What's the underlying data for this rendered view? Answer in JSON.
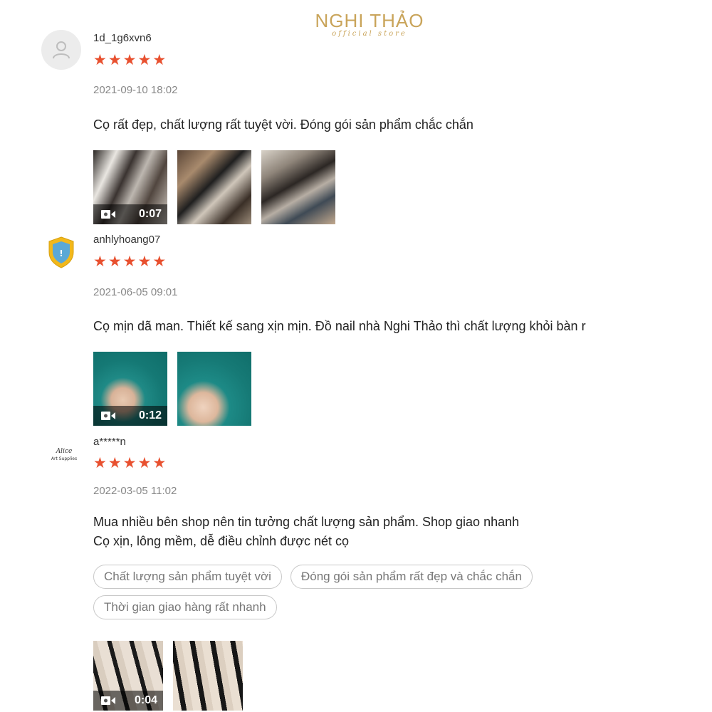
{
  "brand": {
    "name": "NGHI THẢO",
    "subtitle": "official store"
  },
  "reviews": [
    {
      "username": "1d_1g6xvn6",
      "avatar": "user-silhouette-icon",
      "rating": 5,
      "date": "2021-09-10 18:02",
      "comment": [
        "Cọ rất đẹp, chất lượng rất tuyệt vời. Đóng gói sản phẩm chắc chắn"
      ],
      "video_duration": "0:07",
      "media_count": 3
    },
    {
      "username": "anhlyhoang07",
      "avatar": "gold-shield-badge-icon",
      "rating": 5,
      "date": "2021-06-05 09:01",
      "comment": [
        "Cọ mịn dã man. Thiết kế sang xịn mịn. Đồ nail nhà Nghi Thảo thì chất lượng khỏi bàn r"
      ],
      "video_duration": "0:12",
      "media_count": 2
    },
    {
      "username": "a*****n",
      "avatar": "art-supplies-logo",
      "avatar_text": {
        "line1": "Alice",
        "line2": "Art Supplies"
      },
      "rating": 5,
      "date": "2022-03-05 11:02",
      "comment": [
        "Mua nhiều bên shop nên tin tưởng chất lượng sản phẩm. Shop giao nhanh",
        "Cọ xịn, lông mềm, dễ điều chỉnh được nét cọ"
      ],
      "tags": [
        "Chất lượng sản phẩm tuyệt vời",
        "Đóng gói sản phẩm rất đẹp và chắc chắn",
        "Thời gian giao hàng rất nhanh"
      ],
      "video_duration": "0:04",
      "media_count": 2
    }
  ],
  "colors": {
    "star": "#e8502f",
    "brand_gold": "#c9a45a",
    "date": "#888888"
  }
}
